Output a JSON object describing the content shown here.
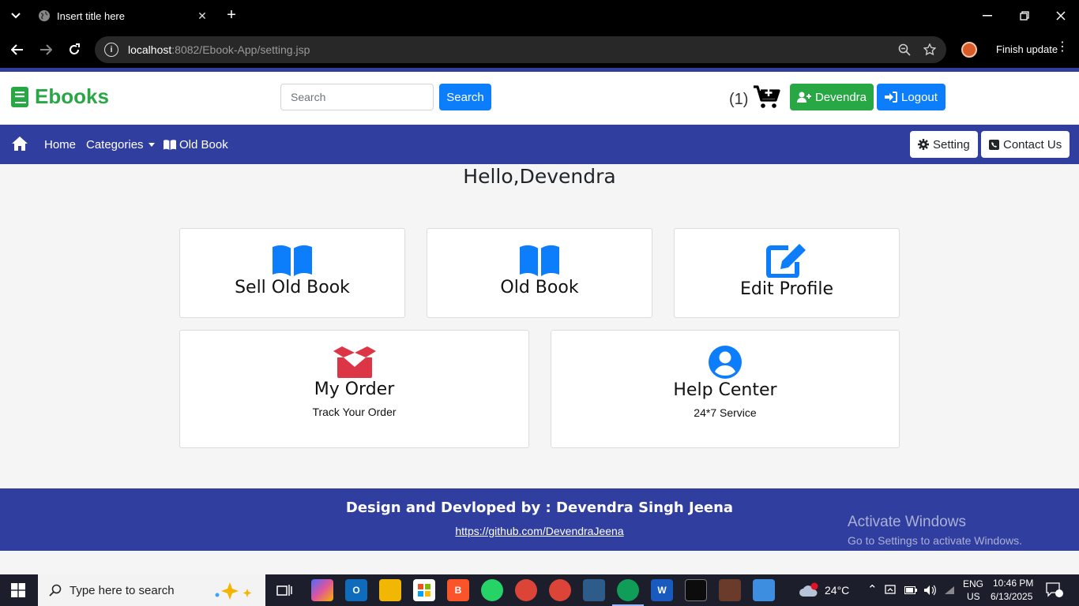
{
  "browser": {
    "tab_title": "Insert title here",
    "url_host": "localhost",
    "url_path": ":8082/Ebook-App/setting.jsp",
    "finish_update_label": "Finish update"
  },
  "header": {
    "brand": "Ebooks",
    "search_placeholder": "Search",
    "search_button": "Search",
    "cart_count": "(1)",
    "user_button": "Devendra",
    "logout_button": "Logout"
  },
  "nav": {
    "home": "Home",
    "categories": "Categories",
    "old_book": "Old Book",
    "setting": "Setting",
    "contact": "Contact Us"
  },
  "main": {
    "greeting": "Hello,Devendra",
    "cards": [
      {
        "title": "Sell Old Book",
        "icon": "book-open-icon",
        "color": "#0d7efb"
      },
      {
        "title": "Old Book",
        "icon": "book-open-icon",
        "color": "#0d7efb"
      },
      {
        "title": "Edit Profile",
        "icon": "edit-icon",
        "color": "#0d7efb"
      },
      {
        "title": "My Order",
        "subtitle": "Track Your Order",
        "icon": "box-open-icon",
        "color": "#dc3545"
      },
      {
        "title": "Help Center",
        "subtitle": "24*7 Service",
        "icon": "user-circle-icon",
        "color": "#0d7efb"
      }
    ]
  },
  "footer": {
    "credit": "Design and Devloped by : Devendra Singh Jeena",
    "link": "https://github.com/DevendraJeena"
  },
  "watermark": {
    "title": "Activate Windows",
    "subtitle": "Go to Settings to activate Windows."
  },
  "taskbar": {
    "search_placeholder": "Type here to search",
    "weather": "24°C",
    "lang_line1": "ENG",
    "lang_line2": "US",
    "time": "10:46 PM",
    "date": "6/13/2025",
    "notification_count": "1"
  },
  "colors": {
    "brand_green": "#28a745",
    "primary_blue": "#0d7efb",
    "nav_indigo": "#303f9f",
    "danger_red": "#dc3545"
  }
}
